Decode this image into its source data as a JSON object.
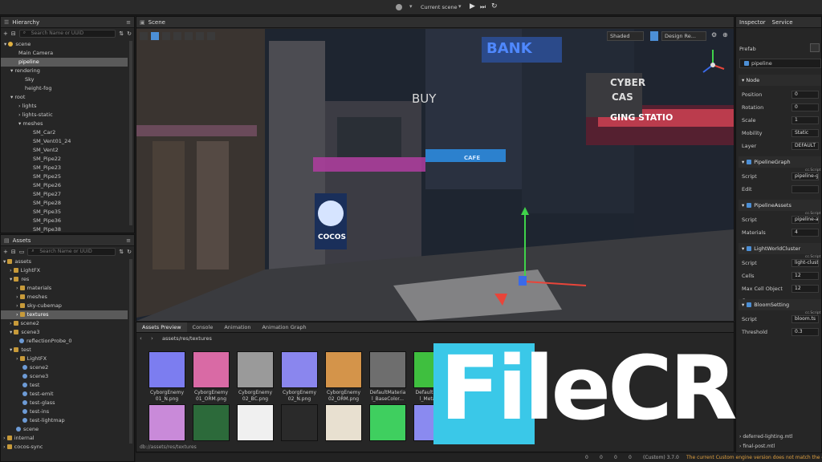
{
  "topbar": {
    "scene_dropdown": "Current scene",
    "play_icon": "play-icon",
    "step_icon": "step-icon",
    "refresh_icon": "refresh-icon"
  },
  "hierarchy": {
    "title": "Hierarchy",
    "search_placeholder": "Search Name or UUID",
    "items": [
      "scene",
      "Main Camera",
      "pipeline",
      "rendering",
      "Sky",
      "height-fog",
      "root",
      "lights",
      "lights-static",
      "meshes",
      "SM_Car2",
      "SM_Vent01_24",
      "SM_Vent2",
      "SM_Pipe22",
      "SM_Pipe23",
      "SM_Pipe25",
      "SM_Pipe26",
      "SM_Pipe27",
      "SM_Pipe28",
      "SM_Pipe35",
      "SM_Pipe36",
      "SM_Pipe38"
    ]
  },
  "assets": {
    "title": "Assets",
    "search_placeholder": "Search Name or UUID",
    "items": [
      "assets",
      "LightFX",
      "res",
      "materials",
      "meshes",
      "sky-cubemap",
      "textures",
      "scene2",
      "scene3",
      "reflectionProbe_0",
      "test",
      "LightFX",
      "scene2",
      "scene3",
      "test",
      "test-emit",
      "test-glass",
      "test-ins",
      "test-lightmap",
      "scene",
      "internal",
      "cocos-sync"
    ]
  },
  "scene_panel": {
    "title": "Scene",
    "shading": "Shaded",
    "camera": "Design Re...",
    "signs": {
      "bank": "BANK",
      "buy": "BUY",
      "cyber": "CYBER",
      "cas": "CAS",
      "station": "GING STATIO",
      "cocos": "COCOS",
      "cafe": "CAFE"
    }
  },
  "bottom_tabs": [
    "Assets Preview",
    "Console",
    "Animation",
    "Animation Graph"
  ],
  "breadcrumb": "assets/res/textures",
  "thumbnails": [
    {
      "label": "CyborgEnemy 01_N.png",
      "color": "#7c7df0"
    },
    {
      "label": "CyborgEnemy 01_ORM.png",
      "color": "#d96aa5"
    },
    {
      "label": "CyborgEnemy 02_BC.png",
      "color": "#9a9a9a"
    },
    {
      "label": "CyborgEnemy 02_N.png",
      "color": "#8a86ee"
    },
    {
      "label": "CyborgEnemy 02_ORM.png",
      "color": "#d4944a"
    },
    {
      "label": "DefaultMateria l_BaseColor...",
      "color": "#6e6e6e"
    },
    {
      "label": "DefaultMateri l_Metalli...",
      "color": "#3fbf3f"
    },
    {
      "label": "DefaultMaterial _Normal.png",
      "color": "#8d8df0"
    }
  ],
  "thumbnails_row2": [
    "#c98ad9",
    "#2c6a3a",
    "#f0f0f0",
    "#2a2a2a",
    "#e8e0d0",
    "#3fcf5f",
    "#8a8af0"
  ],
  "footer_path": "db://assets/res/textures",
  "status": {
    "counts": [
      "0",
      "0",
      "0",
      "0"
    ],
    "version": "(Custom) 3.7.0",
    "message": "The current Custom engine version does not match the edi"
  },
  "inspector": {
    "tabs": [
      "Inspector",
      "Service"
    ],
    "prefab": "Prefab",
    "node_name": "pipeline",
    "node_section": "Node",
    "rows": [
      {
        "k": "Position",
        "v": "0"
      },
      {
        "k": "Rotation",
        "v": "0"
      },
      {
        "k": "Scale",
        "v": "1"
      },
      {
        "k": "Mobility",
        "v": "Static"
      },
      {
        "k": "Layer",
        "v": "DEFAULT"
      }
    ],
    "sections": [
      {
        "name": "PipelineGraph",
        "rows": [
          {
            "k": "Script",
            "v": "pipeline-gra"
          },
          {
            "k": "Edit",
            "v": ""
          }
        ]
      },
      {
        "name": "PipelineAssets",
        "rows": [
          {
            "k": "Script",
            "v": "pipeline-ass"
          },
          {
            "k": "Materials",
            "v": "4"
          }
        ]
      },
      {
        "name": "LightWorldCluster",
        "rows": [
          {
            "k": "Script",
            "v": "light-cluster"
          },
          {
            "k": "Cells",
            "v": "12"
          },
          {
            "k": "Max Cell Object C...",
            "v": "12"
          }
        ]
      },
      {
        "name": "BloomSetting",
        "rows": [
          {
            "k": "Script",
            "v": "bloom.ts"
          },
          {
            "k": "Threshold",
            "v": "0.3"
          }
        ]
      }
    ],
    "mini_labels": [
      "cc.Script",
      "cc.Script",
      "cc.Script",
      "cc.Script"
    ],
    "bottom_items": [
      "deferred-lighting.mtl",
      "final-post.mtl"
    ]
  },
  "watermark": "FileCR",
  "colors": {
    "accent": "#4c8fd6",
    "panel": "#262626",
    "selected": "#5a5a5a"
  }
}
